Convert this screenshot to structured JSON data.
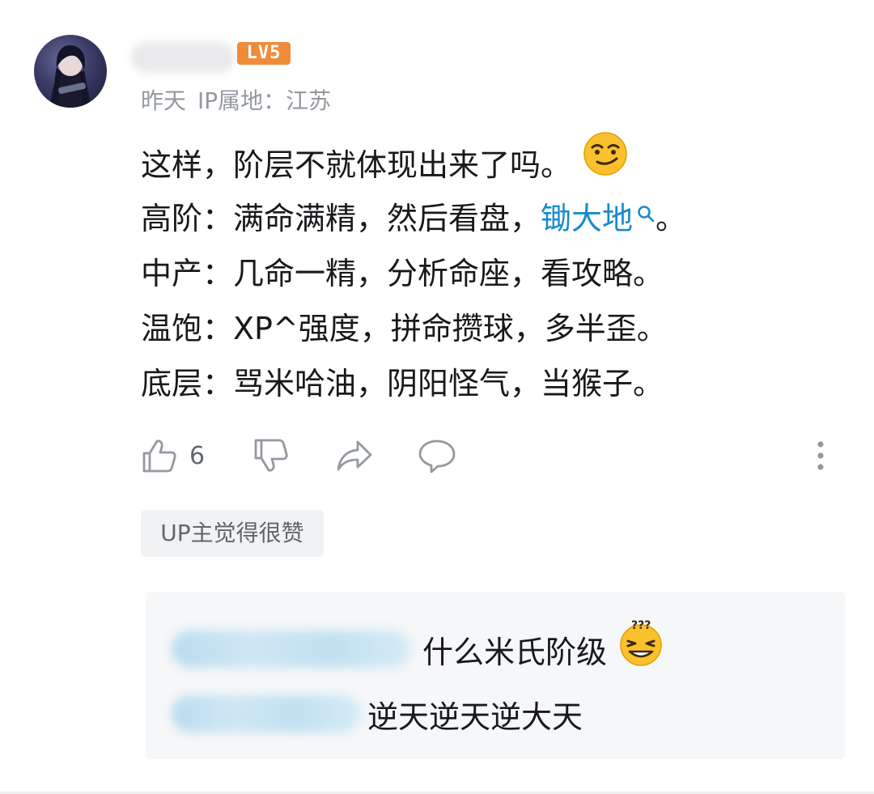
{
  "comment": {
    "level_badge": "LV5",
    "meta": {
      "time": "昨天",
      "ip_location": "IP属地：江苏"
    },
    "content": {
      "line1": "这样，阶层不就体现出来了吗。",
      "line2_prefix": "高阶：满命满精，然后看盘，",
      "line2_link": "锄大地",
      "line2_suffix": "。",
      "line3": "中产：几命一精，分析命座，看攻略。",
      "line4": "温饱：XP^强度，拼命攒球，多半歪。",
      "line5": "底层：骂米哈油，阴阳怪气，当猴子。"
    },
    "actions": {
      "like_count": "6"
    },
    "up_tag": "UP主觉得很赞"
  },
  "replies": [
    {
      "text": "什么米氏阶级"
    },
    {
      "text": "逆天逆天逆大天"
    }
  ],
  "colors": {
    "level_badge": "#f08b3a",
    "link": "#178bcf",
    "meta_text": "#9499a0",
    "icon": "#9499a0",
    "reply_bg": "#f6f7f8",
    "tag_bg": "#f1f2f3"
  },
  "icons": {
    "like": "thumbs-up-icon",
    "dislike": "thumbs-down-icon",
    "share": "share-arrow-icon",
    "reply": "chat-bubble-icon",
    "more": "more-vertical-icon",
    "search": "search-icon",
    "emoji1": "smirk-emoji-icon",
    "emoji2": "confused-grin-emoji-icon"
  }
}
